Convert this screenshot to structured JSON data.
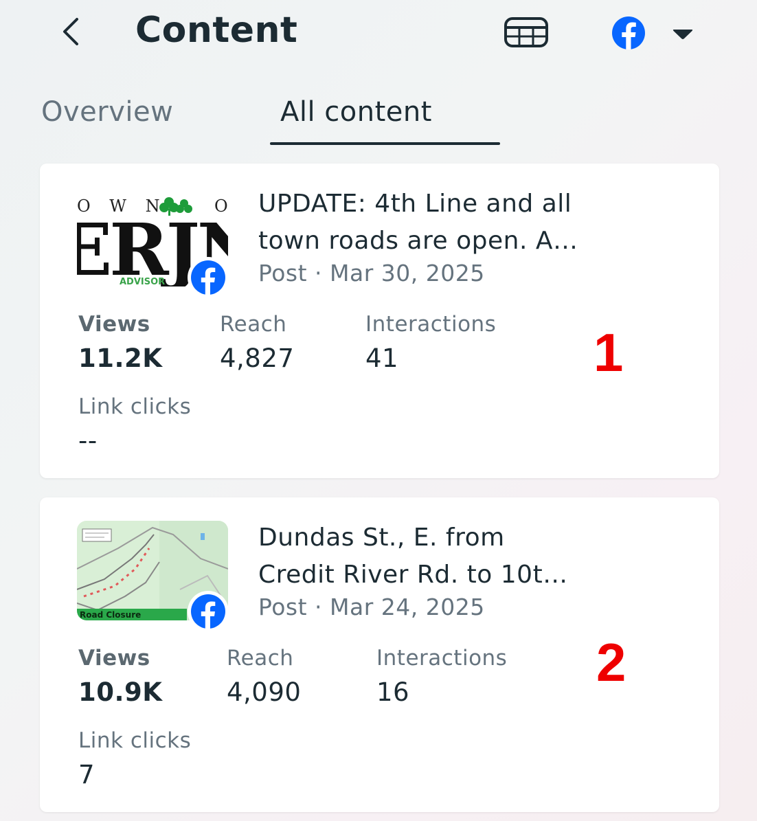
{
  "header": {
    "title": "Content",
    "back_icon": "chevron-left-icon",
    "table_icon": "table-icon",
    "account_icon": "facebook-icon",
    "caret_icon": "caret-down-icon"
  },
  "tabs": [
    {
      "label": "Overview",
      "selected": false
    },
    {
      "label": "All content",
      "selected": true
    }
  ],
  "posts": [
    {
      "title_line1": "UPDATE: 4th Line and all",
      "title_line2": "town roads are open. A…",
      "meta": "Post · Mar 30, 2025",
      "thumbnail_text_top": "O W N",
      "thumbnail_text_top_right": "O",
      "thumbnail_text_big": "ERJN",
      "thumbnail_text_small": "ADVISOR",
      "metrics": {
        "views": {
          "label": "Views",
          "value": "11.2K"
        },
        "reach": {
          "label": "Reach",
          "value": "4,827"
        },
        "interactions": {
          "label": "Interactions",
          "value": "41"
        },
        "link_clicks": {
          "label": "Link clicks",
          "value": "--"
        }
      },
      "annotation": "1"
    },
    {
      "title_line1": "Dundas St., E. from",
      "title_line2": "Credit River Rd. to 10t…",
      "meta": "Post · Mar 24, 2025",
      "thumbnail_text_small": "Road Closure",
      "metrics": {
        "views": {
          "label": "Views",
          "value": "10.9K"
        },
        "reach": {
          "label": "Reach",
          "value": "4,090"
        },
        "interactions": {
          "label": "Interactions",
          "value": "16"
        },
        "link_clicks": {
          "label": "Link clicks",
          "value": "7"
        }
      },
      "annotation": "2"
    }
  ],
  "colors": {
    "facebook_blue": "#0866ff",
    "text_primary": "#1c2b33",
    "text_secondary": "#65737e",
    "annotation_red": "#ee0000"
  }
}
